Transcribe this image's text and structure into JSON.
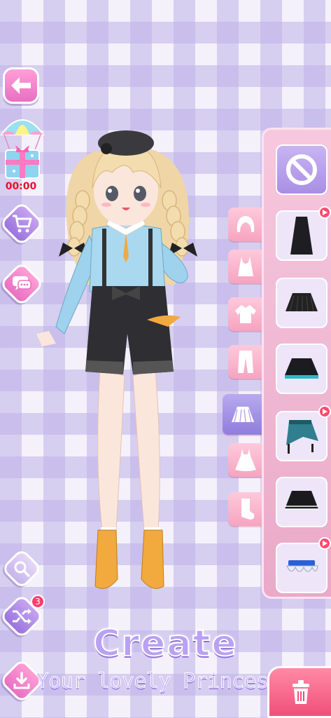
{
  "hud": {
    "timer": "00:00",
    "shuffle_badge": "3"
  },
  "left_buttons": [
    {
      "name": "back",
      "icon": "arrow-left-icon"
    },
    {
      "name": "gift",
      "icon": "parachute-gift-icon"
    },
    {
      "name": "shop",
      "icon": "cart-icon"
    },
    {
      "name": "chat",
      "icon": "chat-bubble-icon"
    },
    {
      "name": "zoom",
      "icon": "magnifier-icon"
    },
    {
      "name": "shuffle",
      "icon": "shuffle-icon"
    },
    {
      "name": "save",
      "icon": "download-icon"
    }
  ],
  "categories": [
    {
      "name": "hair",
      "icon": "hair-icon"
    },
    {
      "name": "top",
      "icon": "camisole-icon"
    },
    {
      "name": "blouse",
      "icon": "shirt-icon"
    },
    {
      "name": "pants",
      "icon": "pants-icon"
    },
    {
      "name": "skirt",
      "icon": "skirt-icon",
      "active": true
    },
    {
      "name": "dress",
      "icon": "dress-icon"
    },
    {
      "name": "socks",
      "icon": "sock-icon"
    }
  ],
  "items": [
    {
      "name": "none",
      "icon": "no-symbol-icon"
    },
    {
      "name": "long-black-skirt",
      "icon": "skirt-long-icon",
      "video_unlock": true
    },
    {
      "name": "black-pleated-skirt",
      "icon": "skirt-pleated-icon"
    },
    {
      "name": "black-teal-skirt",
      "icon": "skirt-teal-trim-icon"
    },
    {
      "name": "teal-wrap-skirt",
      "icon": "skirt-wrap-icon",
      "video_unlock": true
    },
    {
      "name": "black-sailor-skirt",
      "icon": "skirt-sailor-icon"
    },
    {
      "name": "blue-ruffle-skirt",
      "icon": "skirt-ruffle-icon",
      "video_unlock": true
    }
  ],
  "title": "Create",
  "tagline": "Your lovely Princess",
  "colors": {
    "accent_purple": "#b9a1f3",
    "accent_pink": "#e86fc2",
    "timer_red": "#e8102c",
    "panel_pink": "#f6c8de"
  }
}
